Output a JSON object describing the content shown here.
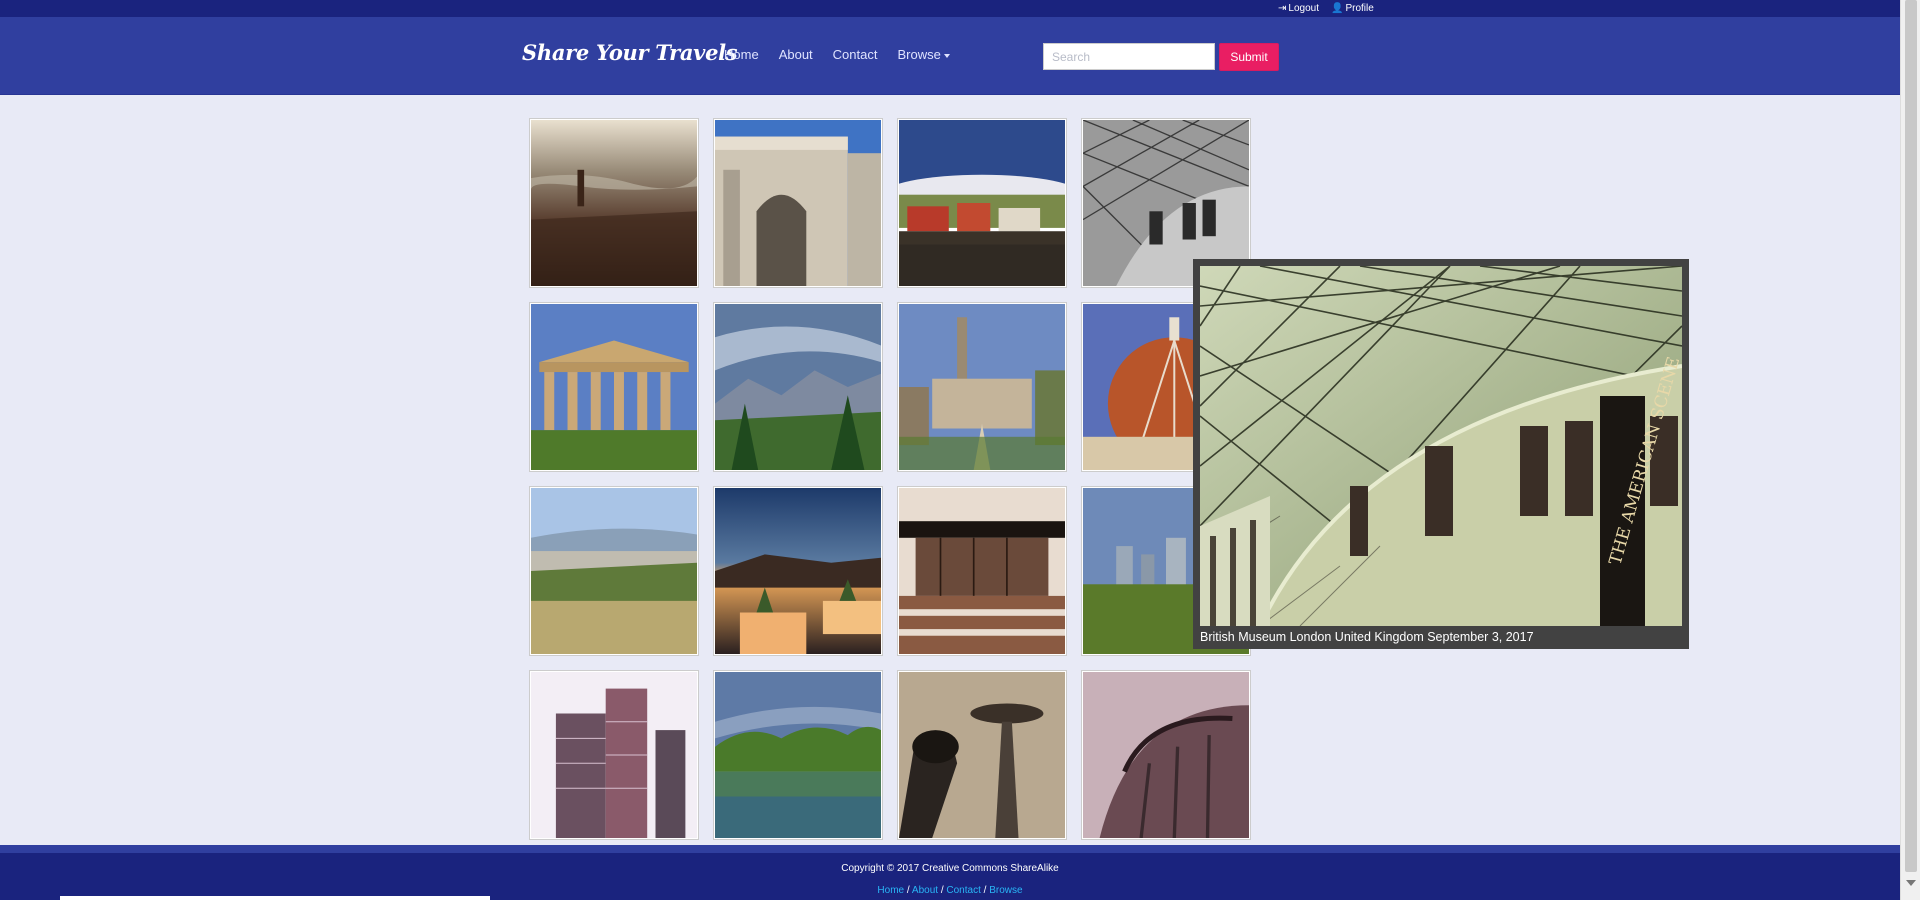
{
  "topbar": {
    "logout_label": "Logout",
    "profile_label": "Profile"
  },
  "navbar": {
    "brand": "Share Your Travels",
    "menu": [
      "Home",
      "About",
      "Contact",
      "Browse"
    ],
    "search_placeholder": "Search",
    "submit_label": "Submit"
  },
  "gallery": {
    "images": [
      "city-river-view",
      "triumphal-arch",
      "harbor-town",
      "museum-atrium",
      "greek-temple",
      "mountain-valley",
      "church-courtyard",
      "cathedral-dome",
      "ancient-theater-hillside",
      "sunset-terrace",
      "modern-pavilion",
      "city-skyline-trees",
      "glass-towers",
      "lake-forest",
      "space-needle",
      "curved-building"
    ]
  },
  "preview": {
    "caption": "British Museum London United Kingdom September 3, 2017",
    "sign_text": "THE AMERICAN SCENE"
  },
  "footer": {
    "copyright": "Copyright © 2017 Creative Commons ShareAlike",
    "links": [
      "Home",
      "About",
      "Contact",
      "Browse"
    ]
  },
  "colors": {
    "topbar": "#1a237e",
    "navbar": "#303f9f",
    "submit": "#e91e63",
    "page_bg": "#e8eaf6",
    "footer_link": "#29b6f6"
  }
}
